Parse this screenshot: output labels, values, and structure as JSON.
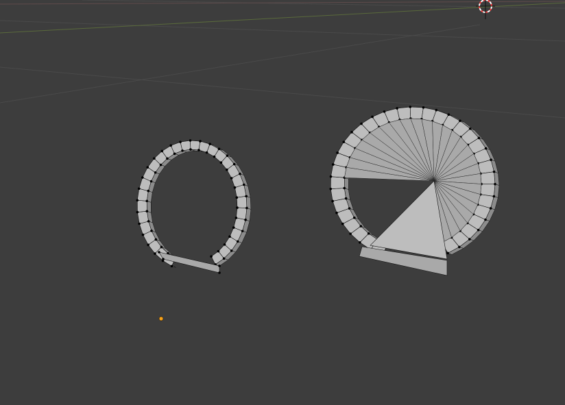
{
  "viewport": {
    "mode": "Edit Mode",
    "background_color": "#3d3d3d",
    "grid_color": "#4a4a4a",
    "x_axis_color": "#5f4b4b",
    "y_axis_color": "#5a6a3c"
  },
  "scene": {
    "cursor": {
      "name": "3d-cursor-icon",
      "colors": [
        "#ff3b3b",
        "#ffffff"
      ]
    },
    "object_origin": {
      "name": "object-origin-dot",
      "color": "#f7a21b"
    },
    "objects": [
      {
        "name": "small-ring-mesh",
        "type": "mesh",
        "open_bottom": true
      },
      {
        "name": "large-ring-mesh",
        "type": "mesh",
        "filled_fan": true
      }
    ],
    "mesh_colors": {
      "face": "#a9a9a9",
      "face_light": "#bdbdbd",
      "side": "#8c8c8c",
      "edge": "#111111",
      "vertex": "#000000"
    }
  }
}
